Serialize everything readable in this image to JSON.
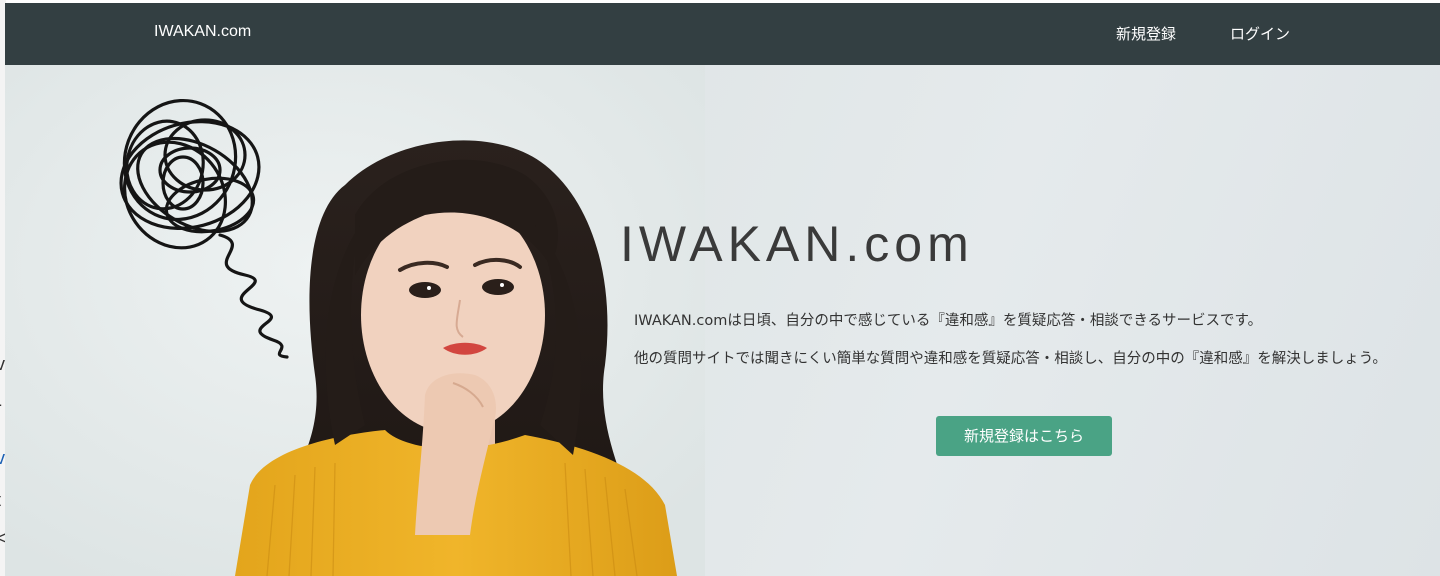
{
  "navbar": {
    "brand": "IWAKAN.com",
    "links": [
      {
        "label": "新規登録"
      },
      {
        "label": "ログイン"
      }
    ],
    "background": "#333f42"
  },
  "hero": {
    "title": "IWAKAN.com",
    "description_1": "IWAKAN.comは日頃、自分の中で感じている『違和感』を質疑応答・相談できるサービスです。",
    "description_2": "他の質問サイトでは聞きにくい簡単な質問や違和感を質疑応答・相談し、自分の中の『違和感』を解決しましょう。",
    "cta_label": "新規登録はこちら",
    "cta_color": "#4aa385",
    "photo_icon": "thinking-woman-photo",
    "scribble_icon": "tangled-scribble-icon"
  },
  "background_window": {
    "fragments": [
      "l",
      "v",
      "-",
      "v",
      "t",
      "<"
    ]
  }
}
